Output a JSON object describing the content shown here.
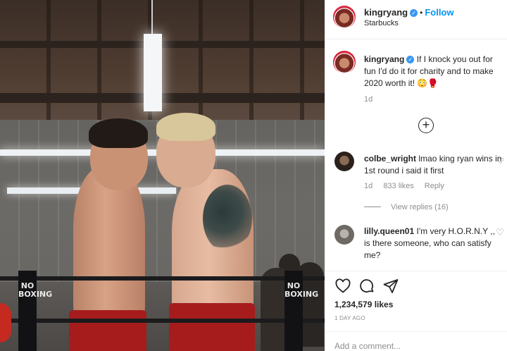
{
  "post": {
    "author": {
      "username": "kingryang",
      "verified": true,
      "follow_label": "Follow",
      "location": "Starbucks"
    },
    "caption": {
      "username": "kingryang",
      "text": "If I knock you out for fun I'd do it for charity and to make 2020 worth it!",
      "emoji": "😳🥊",
      "age": "1d"
    },
    "comments": [
      {
        "username": "colbe_wright",
        "text": "lmao king ryan wins in 1st round i said it first",
        "age": "1d",
        "likes": "833 likes",
        "reply_label": "Reply",
        "view_replies": "View replies (16)"
      },
      {
        "username": "lilly.queen01",
        "text": "I'm very H.O.R.N.Y ,, is there someone, who can satisfy me?"
      }
    ],
    "likes": "1,234,579 likes",
    "posted_ago": "1 DAY AGO",
    "add_comment_placeholder": "Add a comment..."
  },
  "photo": {
    "ring_post_text": "NO BOXING",
    "description_icons": [
      "ring-post",
      "boxing-glove"
    ]
  },
  "colors": {
    "accent": "#0095f6",
    "verified": "#3897f0",
    "shorts": "#a61c1c",
    "muted_text": "#8e8e8e"
  }
}
